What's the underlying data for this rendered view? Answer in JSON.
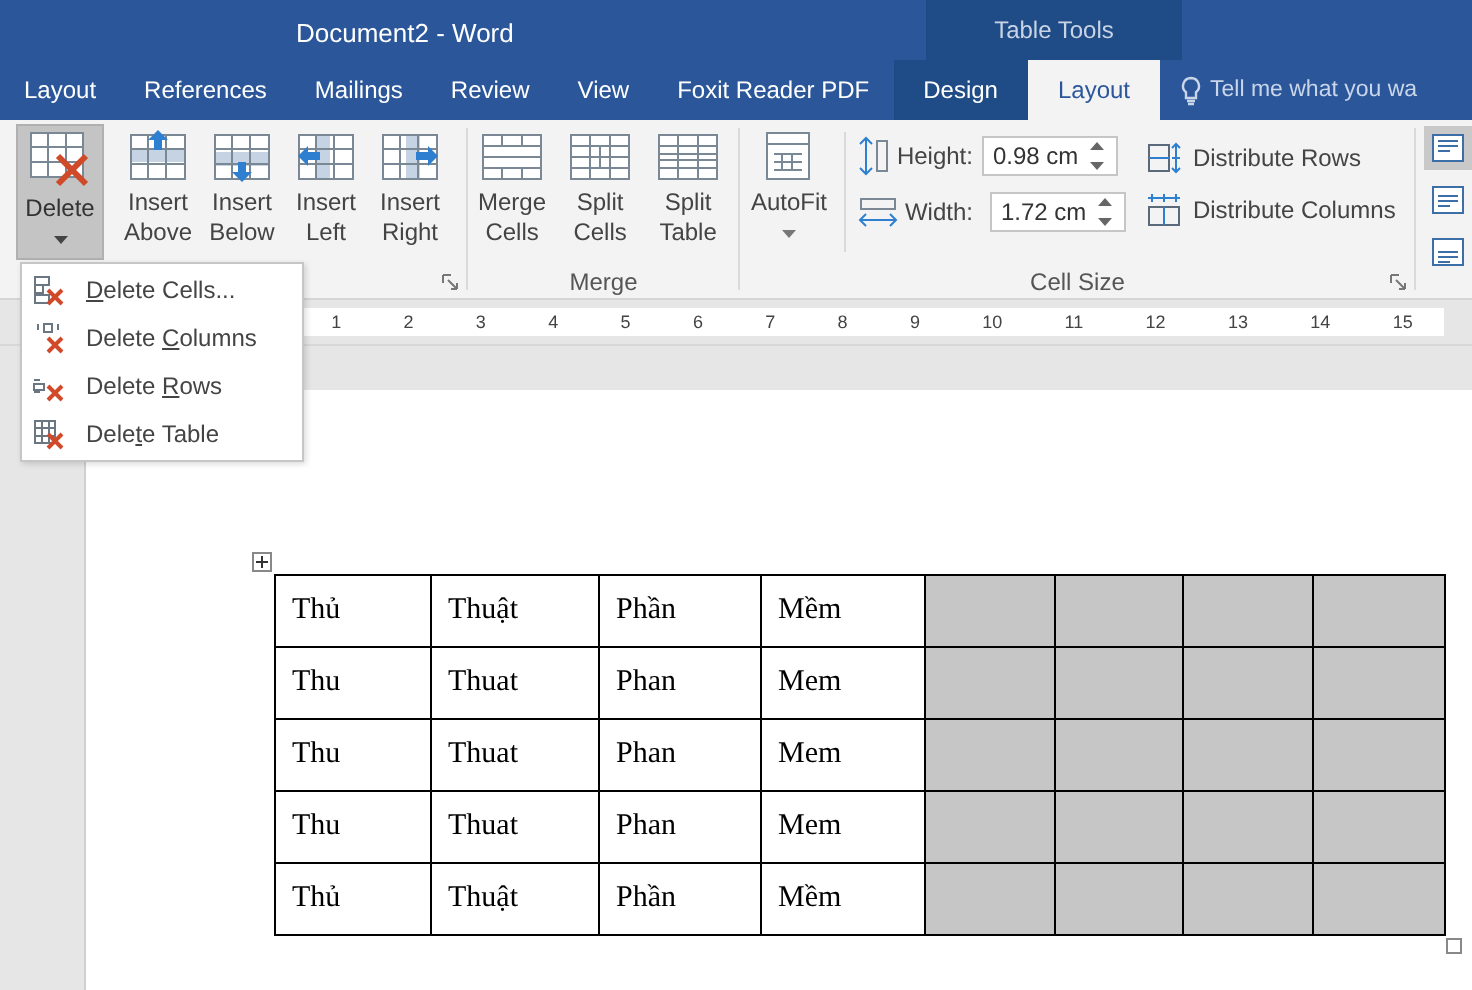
{
  "window": {
    "title": "Document2 - Word"
  },
  "contextual_group": {
    "title": "Table Tools"
  },
  "tabs": [
    {
      "label": "Layout",
      "selected": false,
      "contextual": false
    },
    {
      "label": "References",
      "selected": false,
      "contextual": false
    },
    {
      "label": "Mailings",
      "selected": false,
      "contextual": false
    },
    {
      "label": "Review",
      "selected": false,
      "contextual": false
    },
    {
      "label": "View",
      "selected": false,
      "contextual": false
    },
    {
      "label": "Foxit Reader PDF",
      "selected": false,
      "contextual": false
    },
    {
      "label": "Design",
      "selected": false,
      "contextual": true
    },
    {
      "label": "Layout",
      "selected": true,
      "contextual": true
    }
  ],
  "tell_me": {
    "placeholder": "Tell me what you wa"
  },
  "rows_columns": {
    "buttons": [
      {
        "kind": "delete",
        "label": "Delete",
        "pressed": true
      },
      {
        "kind": "insert_above",
        "label": "Insert Above"
      },
      {
        "kind": "insert_below",
        "label": "Insert Below"
      },
      {
        "kind": "insert_left",
        "label": "Insert Left"
      },
      {
        "kind": "insert_right",
        "label": "Insert Right"
      }
    ]
  },
  "merge": {
    "label": "Merge",
    "buttons": [
      {
        "kind": "merge",
        "label": "Merge Cells"
      },
      {
        "kind": "split_cells",
        "label": "Split Cells"
      },
      {
        "kind": "split_table",
        "label": "Split Table"
      }
    ]
  },
  "cell_size": {
    "label": "Cell Size",
    "autofit": "AutoFit",
    "height": {
      "label": "Height:",
      "value": "0.98 cm"
    },
    "width": {
      "label": "Width:",
      "value": "1.72 cm"
    },
    "distribute": [
      {
        "kind": "rows",
        "label": "Distribute Rows"
      },
      {
        "kind": "columns",
        "label": "Distribute Columns"
      }
    ]
  },
  "alignment": [
    {
      "selected": true
    },
    {
      "selected": false
    },
    {
      "selected": false
    }
  ],
  "ruler": [
    "1",
    "2",
    "3",
    "4",
    "5",
    "6",
    "7",
    "8",
    "9",
    "10",
    "11",
    "12",
    "13",
    "14",
    "15"
  ],
  "delete_menu": [
    {
      "kind": "cells",
      "key": "D",
      "post": "elete Cells..."
    },
    {
      "kind": "columns",
      "pre": "Delete ",
      "key": "C",
      "post": "olumns"
    },
    {
      "kind": "rows",
      "pre": "Delete ",
      "key": "R",
      "post": "ows"
    },
    {
      "kind": "table",
      "pre": "Dele",
      "key": "t",
      "post": "e Table"
    }
  ],
  "table": {
    "rows": [
      {
        "cells": [
          {
            "text": "Thủ",
            "selected": false
          },
          {
            "text": "Thuật",
            "selected": false
          },
          {
            "text": "Phần",
            "selected": false
          },
          {
            "text": "Mềm",
            "selected": false
          },
          {
            "selected": true
          },
          {
            "selected": true
          },
          {
            "selected": true
          },
          {
            "selected": true
          }
        ]
      },
      {
        "cells": [
          {
            "text": "Thu",
            "selected": false
          },
          {
            "text": "Thuat",
            "selected": false
          },
          {
            "text": "Phan",
            "selected": false
          },
          {
            "text": "Mem",
            "selected": false
          },
          {
            "selected": true
          },
          {
            "selected": true
          },
          {
            "selected": true
          },
          {
            "selected": true
          }
        ]
      },
      {
        "cells": [
          {
            "text": "Thu",
            "selected": false
          },
          {
            "text": "Thuat",
            "selected": false
          },
          {
            "text": "Phan",
            "selected": false
          },
          {
            "text": "Mem",
            "selected": false
          },
          {
            "selected": true
          },
          {
            "selected": true
          },
          {
            "selected": true
          },
          {
            "selected": true
          }
        ]
      },
      {
        "cells": [
          {
            "text": "Thu",
            "selected": false
          },
          {
            "text": "Thuat",
            "selected": false
          },
          {
            "text": "Phan",
            "selected": false
          },
          {
            "text": "Mem",
            "selected": false
          },
          {
            "selected": true
          },
          {
            "selected": true
          },
          {
            "selected": true
          },
          {
            "selected": true
          }
        ]
      },
      {
        "cells": [
          {
            "text": "Thủ",
            "selected": false
          },
          {
            "text": "Thuật",
            "selected": false
          },
          {
            "text": "Phần",
            "selected": false
          },
          {
            "text": "Mềm",
            "selected": false
          },
          {
            "selected": true
          },
          {
            "selected": true
          },
          {
            "selected": true
          },
          {
            "selected": true
          }
        ]
      }
    ]
  }
}
